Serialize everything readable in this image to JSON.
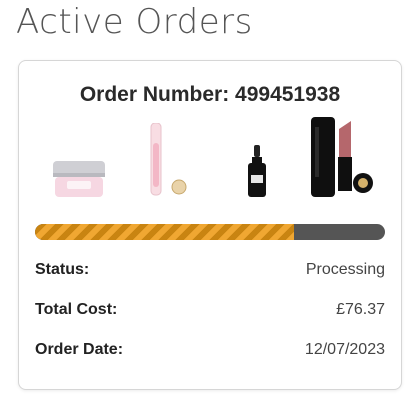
{
  "page": {
    "title": "Active Orders"
  },
  "order": {
    "order_number_label": "Order Number: 499451938",
    "progress_fraction": 0.74,
    "colors": {
      "progress_fill": "#f0a732",
      "progress_track": "#555555"
    },
    "products": [
      {
        "name": "cream-jar"
      },
      {
        "name": "lip-gloss"
      },
      {
        "name": "serum-bottle"
      },
      {
        "name": "lipstick"
      }
    ],
    "fields": [
      {
        "label": "Status:",
        "value": "Processing"
      },
      {
        "label": "Total Cost:",
        "value": "£76.37"
      },
      {
        "label": "Order Date:",
        "value": "12/07/2023"
      }
    ]
  }
}
